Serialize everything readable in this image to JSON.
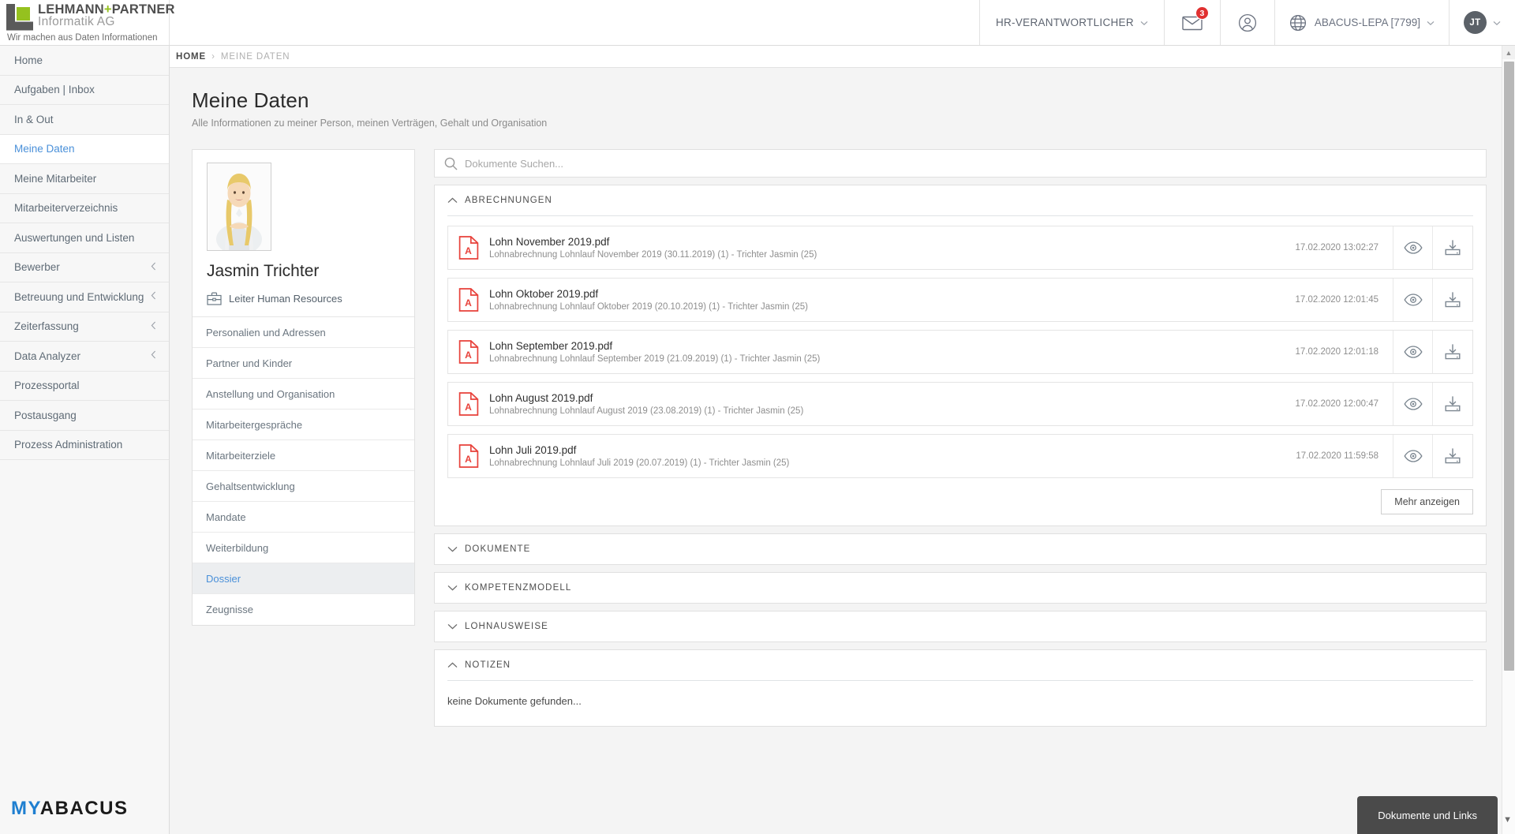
{
  "header": {
    "brand": {
      "line1_a": "LEHMANN",
      "line1_plus": "+",
      "line1_b": "PARTNER",
      "line2": "Informatik AG",
      "tagline": "Wir machen aus Daten Informationen"
    },
    "role_selector": "HR-VERANTWORTLICHER",
    "mail_badge": "3",
    "tenant": "ABACUS-LEPA [7799]",
    "avatar_initials": "JT",
    "icons": {
      "mail": "mail-icon",
      "user": "user-circle-icon",
      "globe": "globe-icon",
      "caret": "chevron-down-icon"
    }
  },
  "sidebar": {
    "items": [
      {
        "label": "Home",
        "active": false,
        "expandable": false
      },
      {
        "label": "Aufgaben | Inbox",
        "active": false,
        "expandable": false
      },
      {
        "label": "In & Out",
        "active": false,
        "expandable": false
      },
      {
        "label": "Meine Daten",
        "active": true,
        "expandable": false
      },
      {
        "label": "Meine Mitarbeiter",
        "active": false,
        "expandable": false
      },
      {
        "label": "Mitarbeiterverzeichnis",
        "active": false,
        "expandable": false
      },
      {
        "label": "Auswertungen und Listen",
        "active": false,
        "expandable": false
      },
      {
        "label": "Bewerber",
        "active": false,
        "expandable": true
      },
      {
        "label": "Betreuung und Entwicklung",
        "active": false,
        "expandable": true
      },
      {
        "label": "Zeiterfassung",
        "active": false,
        "expandable": true
      },
      {
        "label": "Data Analyzer",
        "active": false,
        "expandable": true
      },
      {
        "label": "Prozessportal",
        "active": false,
        "expandable": false
      },
      {
        "label": "Postausgang",
        "active": false,
        "expandable": false
      },
      {
        "label": "Prozess Administration",
        "active": false,
        "expandable": false
      }
    ],
    "logo": {
      "part1": "MY",
      "part2": "ABACUS"
    }
  },
  "breadcrumb": {
    "home": "HOME",
    "separator": "›",
    "current": "MEINE DATEN"
  },
  "page": {
    "title": "Meine Daten",
    "subtitle": "Alle Informationen zu meiner Person, meinen Verträgen, Gehalt und Organisation"
  },
  "profile": {
    "name": "Jasmin Trichter",
    "role": "Leiter Human Resources",
    "role_icon": "briefcase-icon",
    "photo_alt": "employee-photo",
    "menu": [
      {
        "label": "Personalien und Adressen",
        "active": false
      },
      {
        "label": "Partner und Kinder",
        "active": false
      },
      {
        "label": "Anstellung und Organisation",
        "active": false
      },
      {
        "label": "Mitarbeitergespräche",
        "active": false
      },
      {
        "label": "Mitarbeiterziele",
        "active": false
      },
      {
        "label": "Gehaltsentwicklung",
        "active": false
      },
      {
        "label": "Mandate",
        "active": false
      },
      {
        "label": "Weiterbildung",
        "active": false
      },
      {
        "label": "Dossier",
        "active": true
      },
      {
        "label": "Zeugnisse",
        "active": false
      }
    ]
  },
  "search": {
    "placeholder": "Dokumente Suchen...",
    "value": ""
  },
  "sections": [
    {
      "title": "ABRECHNUNGEN",
      "expanded": true,
      "documents": [
        {
          "name": "Lohn November 2019.pdf",
          "description": "Lohnabrechnung Lohnlauf November 2019 (30.11.2019) (1) - Trichter Jasmin (25)",
          "date": "17.02.2020 13:02:27"
        },
        {
          "name": "Lohn Oktober 2019.pdf",
          "description": "Lohnabrechnung Lohnlauf Oktober 2019 (20.10.2019) (1) - Trichter Jasmin (25)",
          "date": "17.02.2020 12:01:45"
        },
        {
          "name": "Lohn September 2019.pdf",
          "description": "Lohnabrechnung Lohnlauf September 2019 (21.09.2019) (1) - Trichter Jasmin (25)",
          "date": "17.02.2020 12:01:18"
        },
        {
          "name": "Lohn August 2019.pdf",
          "description": "Lohnabrechnung Lohnlauf August 2019 (23.08.2019) (1) - Trichter Jasmin (25)",
          "date": "17.02.2020 12:00:47"
        },
        {
          "name": "Lohn Juli 2019.pdf",
          "description": "Lohnabrechnung Lohnlauf Juli 2019 (20.07.2019) (1) - Trichter Jasmin (25)",
          "date": "17.02.2020 11:59:58"
        }
      ],
      "more_label": "Mehr anzeigen"
    },
    {
      "title": "DOKUMENTE",
      "expanded": false
    },
    {
      "title": "KOMPETENZMODELL",
      "expanded": false
    },
    {
      "title": "LOHNAUSWEISE",
      "expanded": false
    },
    {
      "title": "NOTIZEN",
      "expanded": true,
      "empty_text": "keine Dokumente gefunden..."
    }
  ],
  "floating": {
    "docs_links_label": "Dokumente und Links"
  },
  "colors": {
    "accent_blue": "#4a90d9",
    "brand_green": "#95c11f",
    "badge_red": "#e03030",
    "pdf_red": "#e8413a",
    "dark_panel": "#4a4a4a"
  }
}
